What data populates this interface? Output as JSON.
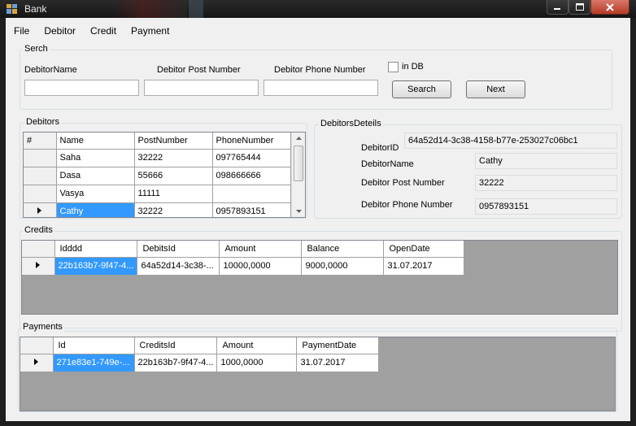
{
  "window": {
    "title": "Bank"
  },
  "menu": [
    "File",
    "Debitor",
    "Credit",
    "Payment"
  ],
  "search": {
    "group_label": "Serch",
    "name_label": "DebitorName",
    "post_label": "Debitor Post Number",
    "phone_label": "Debitor Phone Number",
    "checkbox_label": "in DB",
    "search_button": "Search",
    "next_button": "Next",
    "name_value": "",
    "post_value": "",
    "phone_value": ""
  },
  "debitors": {
    "group_label": "Debitors",
    "columns": [
      "#",
      "Name",
      "PostNumber",
      "PhoneNumber"
    ],
    "rows": [
      {
        "name": "Saha",
        "post": "32222",
        "phone": "097765444"
      },
      {
        "name": "Dasa",
        "post": "55666",
        "phone": "098666666"
      },
      {
        "name": "Vasya",
        "post": "11111",
        "phone": ""
      },
      {
        "name": "Cathy",
        "post": "32222",
        "phone": "0957893151"
      }
    ]
  },
  "details": {
    "group_label": "DebitorsDeteils",
    "id_label": "DebitorID",
    "id_value": "64a52d14-3c38-4158-b77e-253027c06bc1",
    "name_label": "DebitorName",
    "name_value": "Cathy",
    "post_label": "Debitor Post Number",
    "post_value": "32222",
    "phone_label": "Debitor Phone Number",
    "phone_value": "0957893151"
  },
  "credits": {
    "group_label": "Credits",
    "columns": [
      "Idddd",
      "DebitsId",
      "Amount",
      "Balance",
      "OpenDate"
    ],
    "rows": [
      {
        "id": "22b163b7-9f47-4...",
        "debits_id": "64a52d14-3c38-...",
        "amount": "10000,0000",
        "balance": "9000,0000",
        "open_date": "31.07.2017"
      }
    ]
  },
  "payments": {
    "group_label": "Payments",
    "columns": [
      "Id",
      "CreditsId",
      "Amount",
      "PaymentDate"
    ],
    "rows": [
      {
        "id": "271e83e1-749e-...",
        "credits_id": "22b163b7-9f47-4...",
        "amount": "1000,0000",
        "payment_date": "31.07.2017"
      }
    ]
  }
}
